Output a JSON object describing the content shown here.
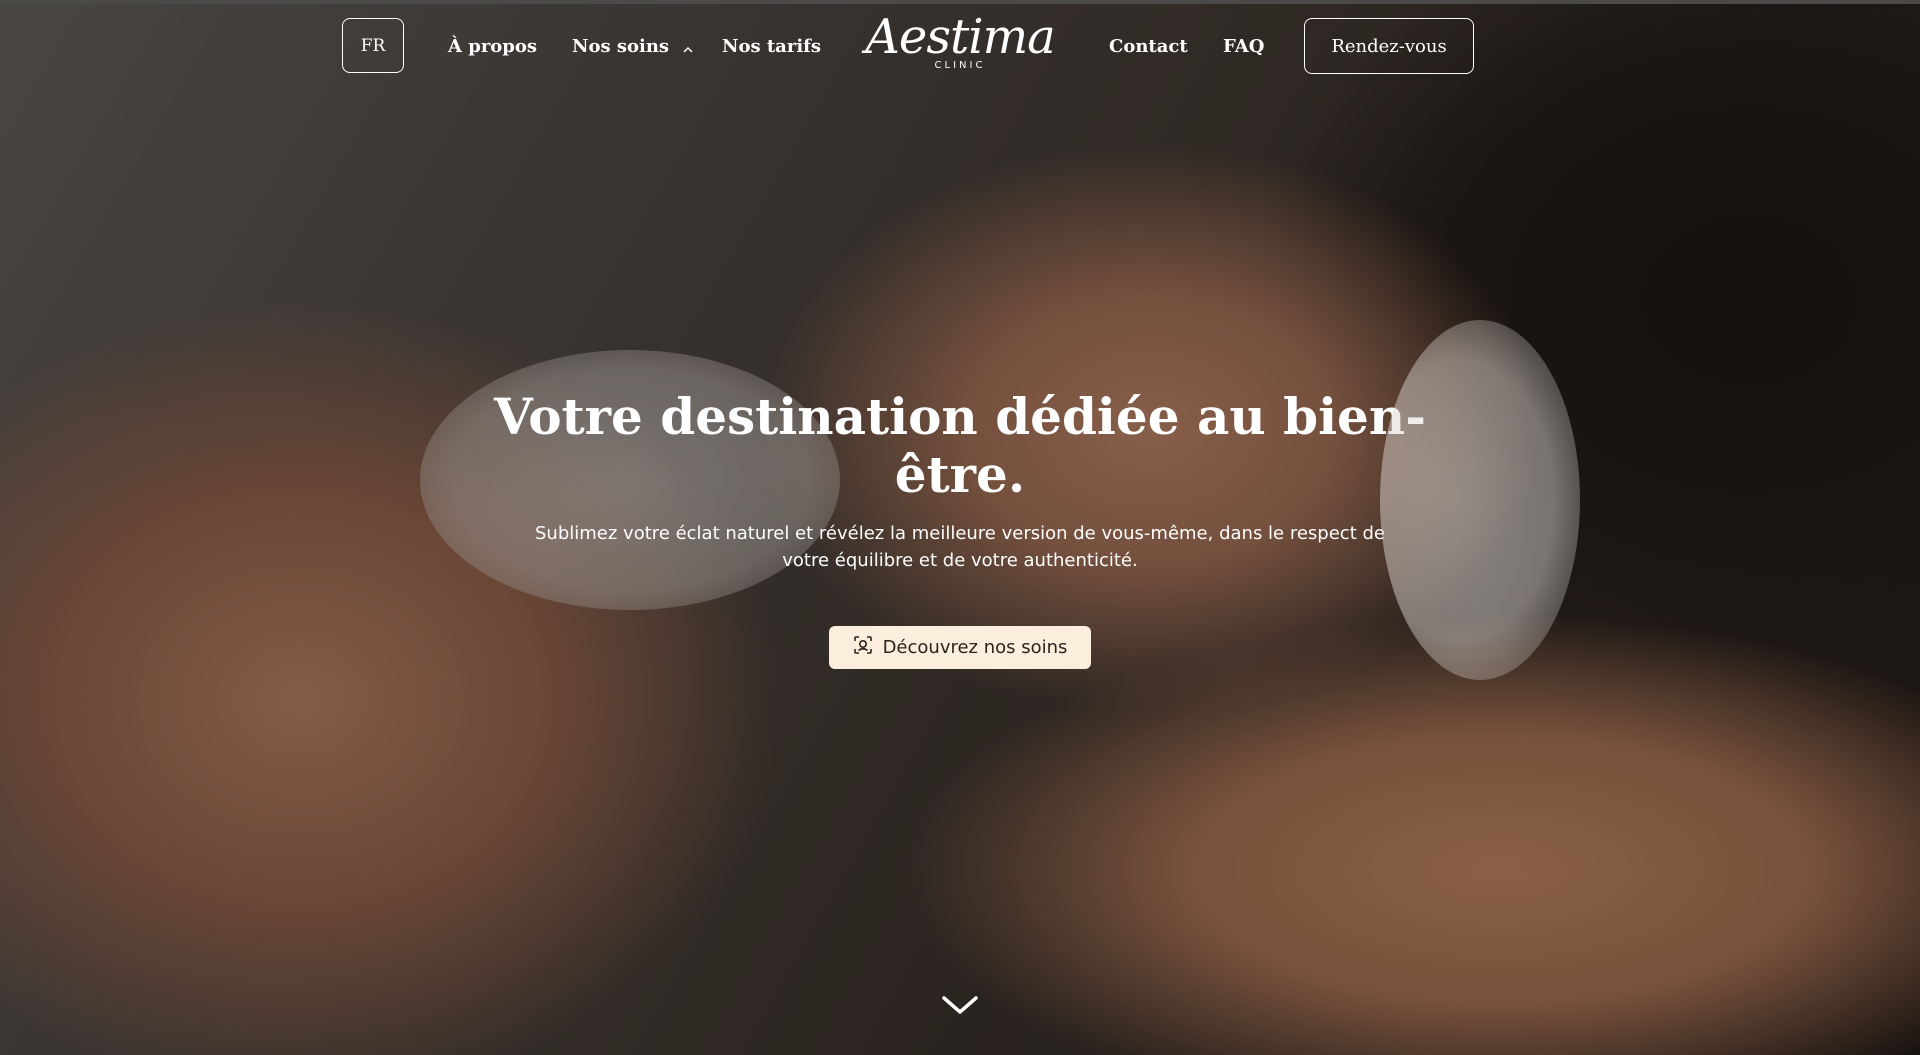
{
  "nav": {
    "lang_label": "FR",
    "about_label": "À propos",
    "services_label": "Nos soins",
    "pricing_label": "Nos tarifs",
    "contact_label": "Contact",
    "faq_label": "FAQ",
    "appointment_label": "Rendez-vous"
  },
  "logo": {
    "name": "Aestima",
    "tagline": "CLINIC"
  },
  "hero": {
    "headline": "Votre destination dédiée au bien-être.",
    "subtitle": "Sublimez votre éclat naturel et révélez la meilleure version de vous-même, dans le respect de votre équilibre et de votre authenticité.",
    "cta_label": "Découvrez nos soins",
    "cta_icon": "face-scan-icon",
    "scroll_icon": "chevron-down-icon"
  },
  "colors": {
    "cta_background": "#fbeedd",
    "text": "#ffffff"
  }
}
